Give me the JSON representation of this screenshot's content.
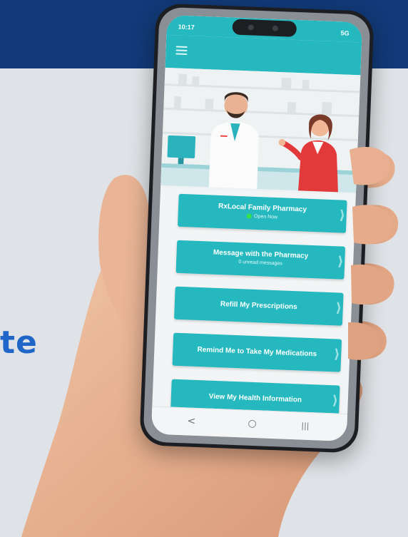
{
  "background": {
    "partial_text": "te",
    "band_color": "#123a78",
    "text_color": "#1f66c8"
  },
  "status_bar": {
    "time": "10:17",
    "right_icons": "5G"
  },
  "app_bar": {
    "menu_icon": "hamburger-menu-icon",
    "color": "#25b9bf"
  },
  "hero": {
    "description_icon": "pharmacist-and-customer-illustration"
  },
  "actions": [
    {
      "label": "RxLocal Family Pharmacy",
      "sub": "Open Now",
      "status_color": "#37e14b"
    },
    {
      "label": "Message with the Pharmacy",
      "sub": "0 unread messages"
    },
    {
      "label": "Refill My Prescriptions"
    },
    {
      "label": "Remind Me to Take My Medications"
    },
    {
      "label": "View My Health Information"
    }
  ],
  "nav": {
    "back": "<",
    "home": "○",
    "recents": "|||"
  }
}
